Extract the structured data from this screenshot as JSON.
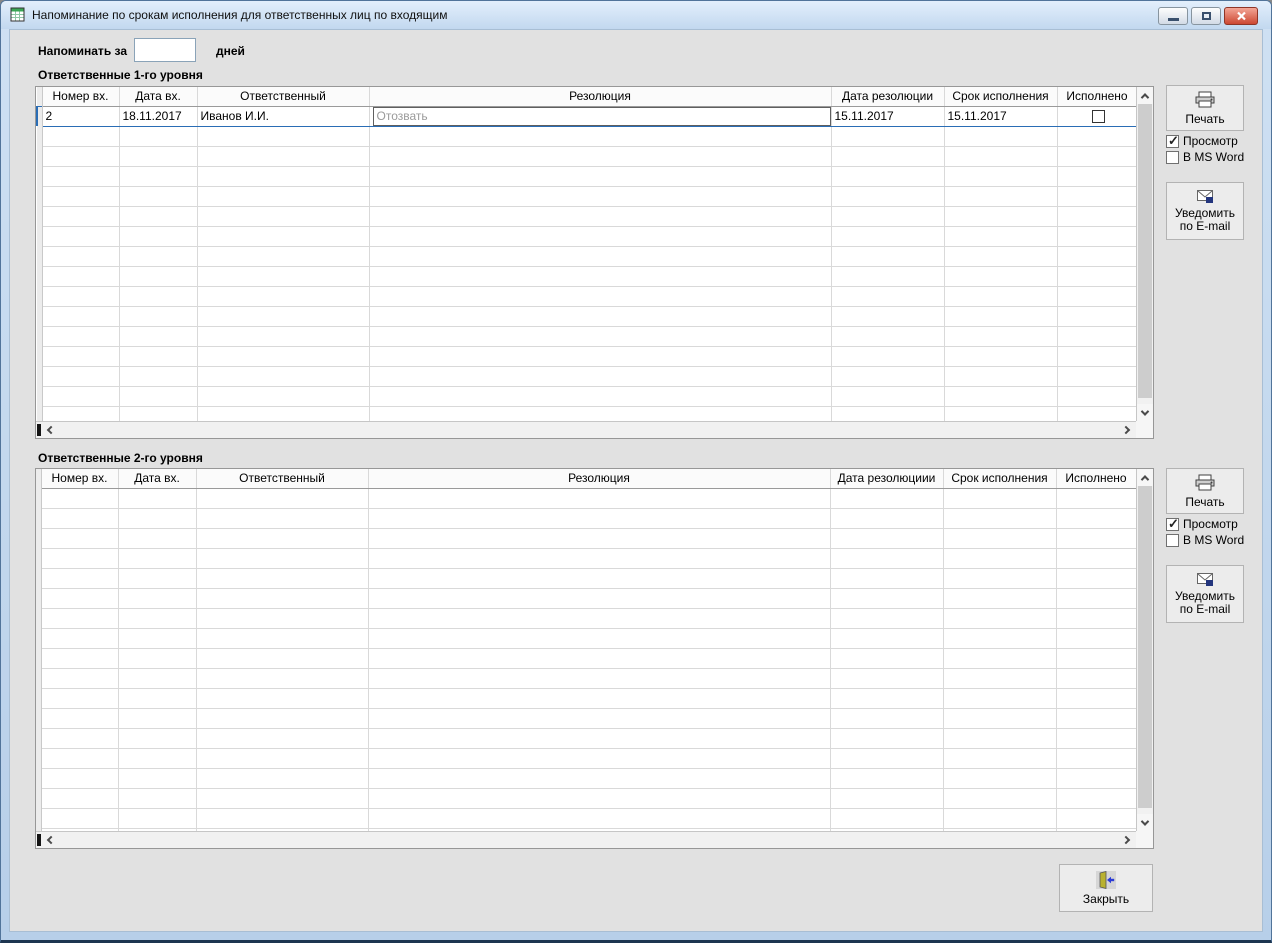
{
  "window": {
    "title": "Напоминание по срокам исполнения для ответственных лиц по входящим"
  },
  "reminder": {
    "label": "Напоминать за",
    "value": "",
    "suffix": "дней"
  },
  "sections": [
    {
      "title": "Ответственные 1-го уровня",
      "columns": [
        "Номер вх.",
        "Дата вх.",
        "Ответственный",
        "Резолюция",
        "Дата резолюции",
        "Срок исполнения",
        "Исполнено"
      ],
      "rows": [
        {
          "num": "2",
          "date": "18.11.2017",
          "responsible": "Иванов И.И.",
          "resolution": "Отозвать",
          "resolution_date": "15.11.2017",
          "deadline": "15.11.2017",
          "done": false
        }
      ],
      "panel": {
        "print_label": "Печать",
        "preview_label": "Просмотр",
        "preview_checked": true,
        "msword_label": "В MS Word",
        "msword_checked": false,
        "notify_label": "Уведомить по E-mail"
      }
    },
    {
      "title": "Ответственные 2-го уровня",
      "columns": [
        "Номер вх.",
        "Дата вх.",
        "Ответственный",
        "Резолюция",
        "Дата резолюциии",
        "Срок исполнения",
        "Исполнено"
      ],
      "rows": [],
      "panel": {
        "print_label": "Печать",
        "preview_label": "Просмотр",
        "preview_checked": true,
        "msword_label": "В MS Word",
        "msword_checked": false,
        "notify_label": "Уведомить по E-mail"
      }
    }
  ],
  "footer": {
    "close_label": "Закрыть"
  },
  "colors": {
    "selection_border": "#2a6db5",
    "close_button_red": "#cc4732",
    "titlebar_blue": "#c2d8ef"
  }
}
